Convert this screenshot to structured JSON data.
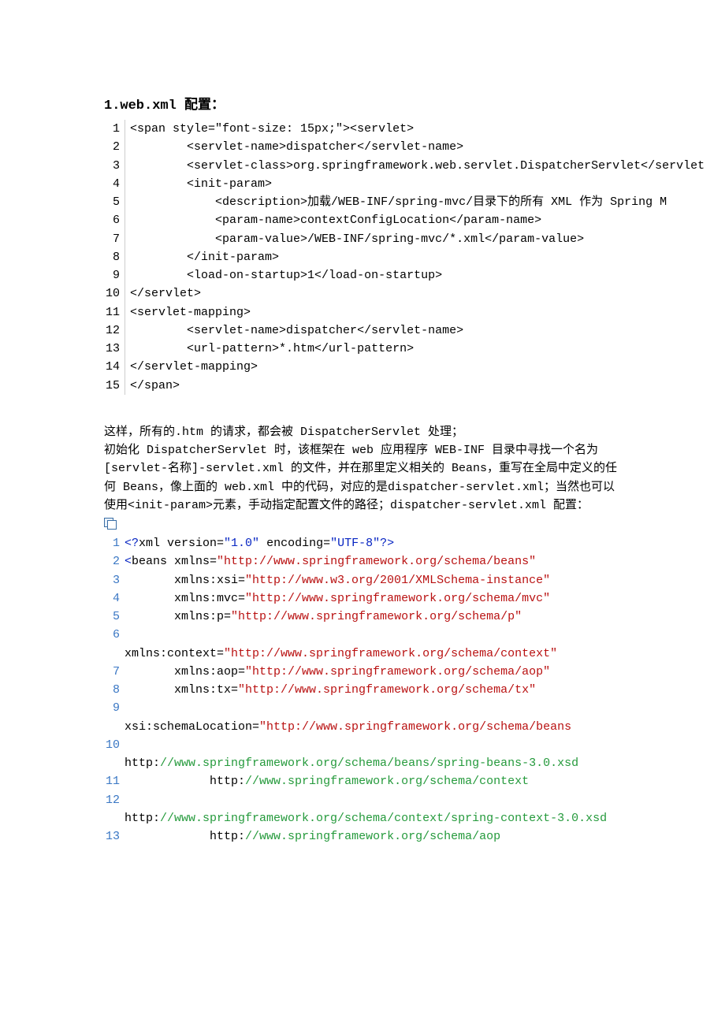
{
  "heading": "1.web.xml 配置：",
  "block1": {
    "lines": [
      "<span style=\"font-size: 15px;\"><servlet>",
      "        <servlet-name>dispatcher</servlet-name>",
      "        <servlet-class>org.springframework.web.servlet.DispatcherServlet</servlet",
      "        <init-param>",
      "            <description>加载/WEB-INF/spring-mvc/目录下的所有 XML 作为 Spring M",
      "            <param-name>contextConfigLocation</param-name>",
      "            <param-value>/WEB-INF/spring-mvc/*.xml</param-value>",
      "        </init-param>",
      "        <load-on-startup>1</load-on-startup>",
      "</servlet>",
      "<servlet-mapping>",
      "        <servlet-name>dispatcher</servlet-name>",
      "        <url-pattern>*.htm</url-pattern>",
      "</servlet-mapping>",
      "</span>"
    ]
  },
  "paragraph": "    这样，所有的.htm 的请求，都会被 DispatcherServlet 处理；\n初始化 DispatcherServlet 时，该框架在 web 应用程序 WEB-INF 目录中寻找一个名为[servlet-名称]-servlet.xml 的文件，并在那里定义相关的 Beans，重写在全局中定义的任何 Beans，像上面的 web.xml 中的代码，对应的是dispatcher-servlet.xml；当然也可以使用<init-param>元素，手动指定配置文件的路径；dispatcher-servlet.xml  配置：",
  "block2": {
    "rows": [
      {
        "n": "1",
        "segs": [
          {
            "cls": "blue",
            "t": "<?"
          },
          {
            "cls": "black",
            "t": "xml version="
          },
          {
            "cls": "blue",
            "t": "\"1.0\""
          },
          {
            "cls": "black",
            "t": " encoding="
          },
          {
            "cls": "blue",
            "t": "\"UTF-8\""
          },
          {
            "cls": "blue",
            "t": "?>"
          }
        ]
      },
      {
        "n": "2",
        "segs": [
          {
            "cls": "blue",
            "t": "<"
          },
          {
            "cls": "black",
            "t": "beans xmlns="
          },
          {
            "cls": "red",
            "t": "\"http://www.springframework.org/schema/beans\""
          }
        ]
      },
      {
        "n": "3",
        "segs": [
          {
            "cls": "black",
            "t": "       xmlns:xsi="
          },
          {
            "cls": "red",
            "t": "\"http://www.w3.org/2001/XMLSchema-instance\""
          }
        ]
      },
      {
        "n": "4",
        "segs": [
          {
            "cls": "black",
            "t": "       xmlns:mvc="
          },
          {
            "cls": "red",
            "t": "\"http://www.springframework.org/schema/mvc\""
          }
        ]
      },
      {
        "n": "5",
        "segs": [
          {
            "cls": "black",
            "t": "       xmlns:p="
          },
          {
            "cls": "red",
            "t": "\"http://www.springframework.org/schema/p\""
          }
        ]
      },
      {
        "n": "6",
        "segs": [
          {
            "cls": "black",
            "t": ""
          }
        ]
      },
      {
        "n": "",
        "noln": true,
        "segs": [
          {
            "cls": "black",
            "t": "xmlns:context="
          },
          {
            "cls": "red",
            "t": "\"http://www.springframework.org/schema/context\""
          }
        ]
      },
      {
        "n": "7",
        "segs": [
          {
            "cls": "black",
            "t": "       xmlns:aop="
          },
          {
            "cls": "red",
            "t": "\"http://www.springframework.org/schema/aop\""
          }
        ]
      },
      {
        "n": "8",
        "segs": [
          {
            "cls": "black",
            "t": "       xmlns:tx="
          },
          {
            "cls": "red",
            "t": "\"http://www.springframework.org/schema/tx\""
          }
        ]
      },
      {
        "n": "9",
        "segs": [
          {
            "cls": "black",
            "t": ""
          }
        ]
      },
      {
        "n": "",
        "noln": true,
        "segs": [
          {
            "cls": "black",
            "t": "xsi:schemaLocation="
          },
          {
            "cls": "red",
            "t": "\"http://www.springframework.org/schema/beans"
          }
        ]
      },
      {
        "n": "10",
        "segs": [
          {
            "cls": "black",
            "t": ""
          }
        ]
      },
      {
        "n": "",
        "noln": true,
        "segs": [
          {
            "cls": "black",
            "t": "http:"
          },
          {
            "cls": "green",
            "t": "//www.springframework.org/schema/beans/spring-beans-3.0.xsd"
          }
        ]
      },
      {
        "n": "11",
        "segs": [
          {
            "cls": "black",
            "t": "            http:"
          },
          {
            "cls": "green",
            "t": "//www.springframework.org/schema/context"
          }
        ]
      },
      {
        "n": "12",
        "segs": [
          {
            "cls": "black",
            "t": ""
          }
        ]
      },
      {
        "n": "",
        "noln": true,
        "segs": [
          {
            "cls": "black",
            "t": "http:"
          },
          {
            "cls": "green",
            "t": "//www.springframework.org/schema/context/spring-context-3.0.xsd"
          }
        ]
      },
      {
        "n": "13",
        "segs": [
          {
            "cls": "black",
            "t": "            http:"
          },
          {
            "cls": "green",
            "t": "//www.springframework.org/schema/aop"
          }
        ]
      }
    ]
  }
}
